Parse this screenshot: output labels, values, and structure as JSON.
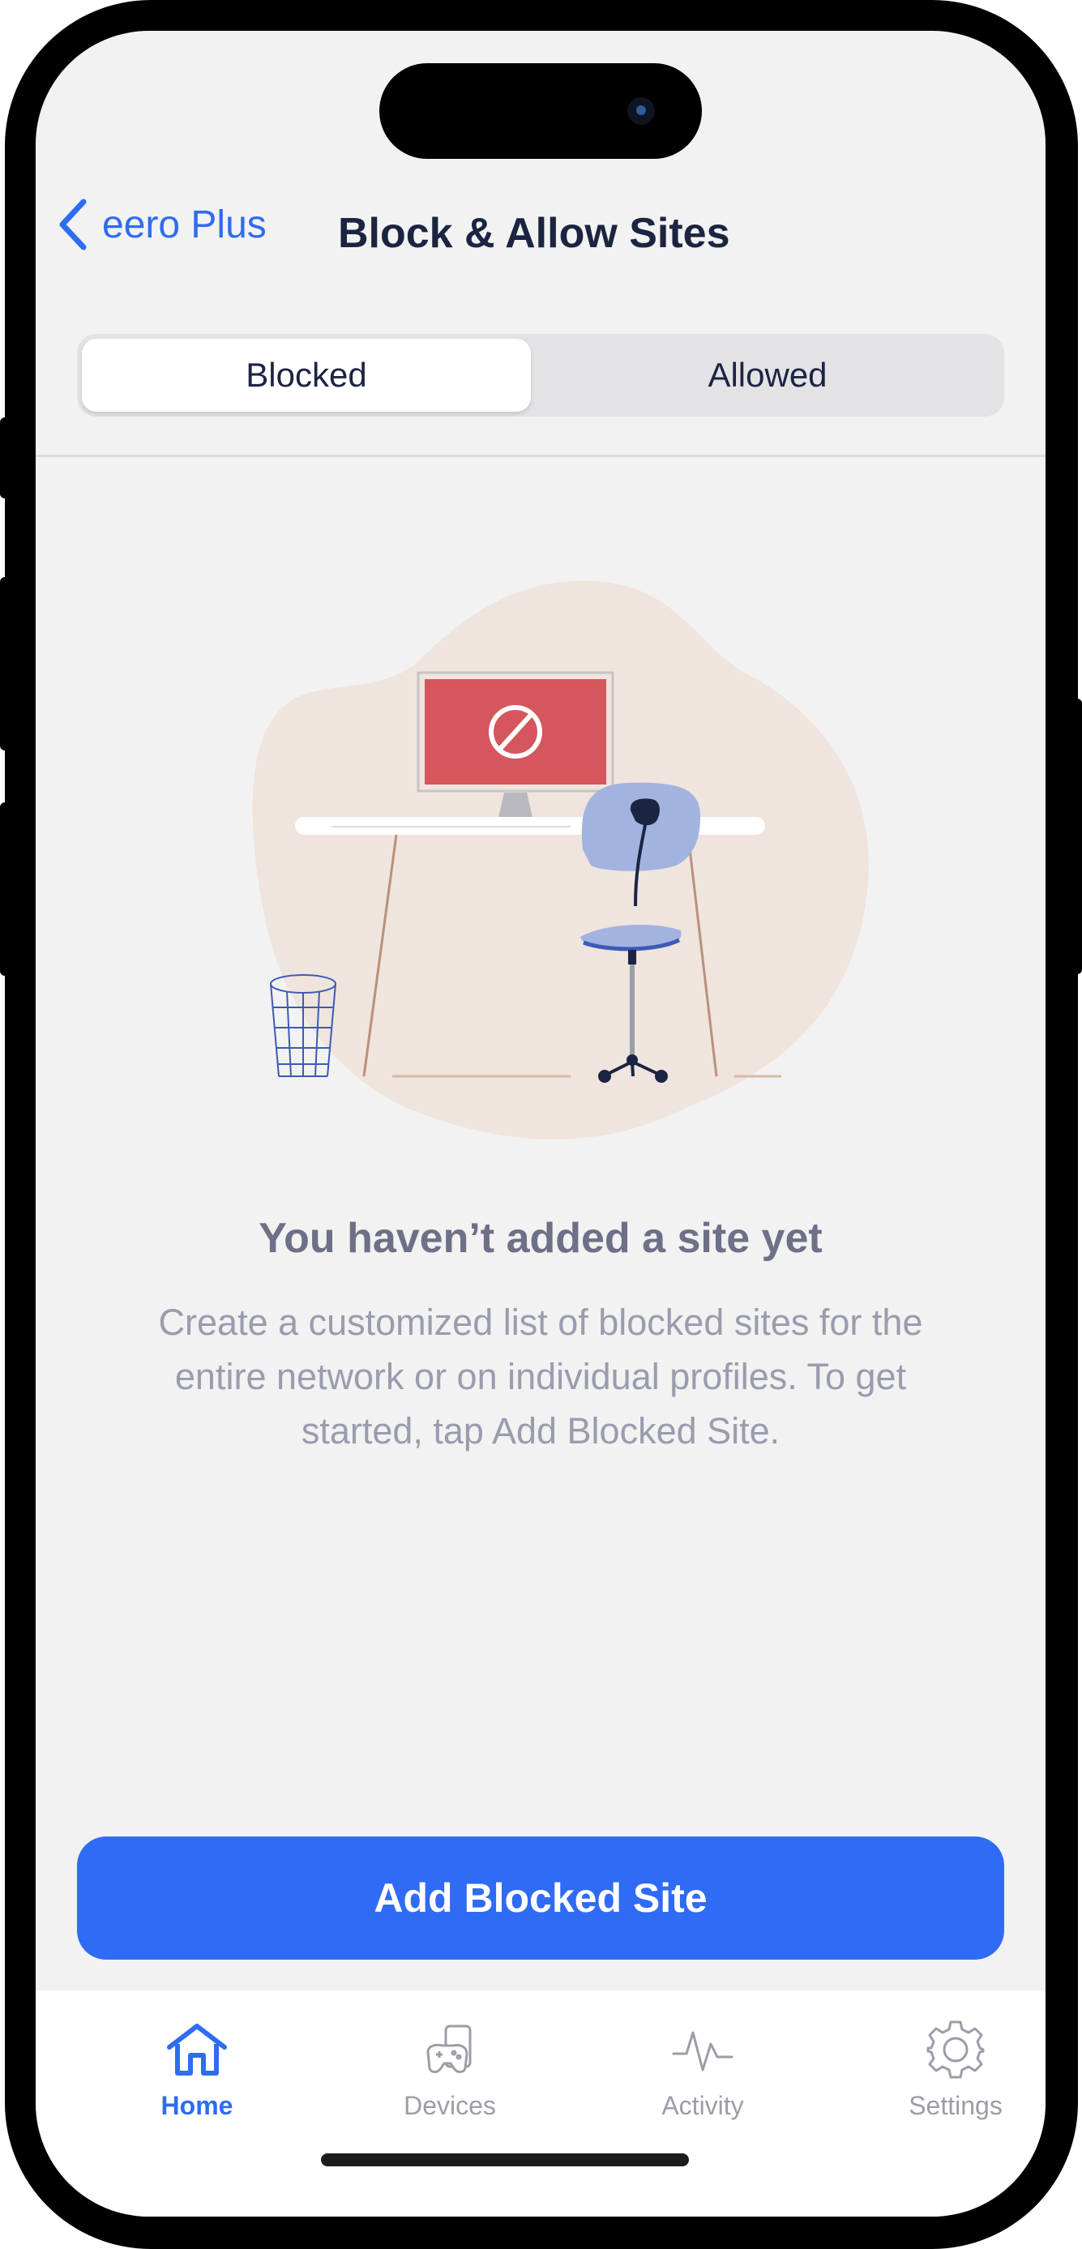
{
  "header": {
    "back_label": "eero Plus",
    "title": "Block & Allow Sites"
  },
  "segments": [
    {
      "label": "Blocked",
      "selected": true
    },
    {
      "label": "Allowed",
      "selected": false
    }
  ],
  "empty_state": {
    "title": "You haven’t added a site yet",
    "description": "Create a customized list of blocked sites for the entire network or on individual profiles. To get started, tap Add Blocked Site."
  },
  "primary_action": {
    "label": "Add Blocked Site"
  },
  "tabbar": {
    "items": [
      {
        "label": "Home",
        "icon": "home-icon",
        "active": true
      },
      {
        "label": "Devices",
        "icon": "devices-icon",
        "active": false
      },
      {
        "label": "Activity",
        "icon": "activity-icon",
        "active": false
      },
      {
        "label": "Settings",
        "icon": "settings-icon",
        "active": false
      }
    ]
  },
  "colors": {
    "accent": "#2e6cf0",
    "primary_button": "#2f6bf5",
    "title_text": "#1b2441",
    "muted_text": "#9a9cae",
    "monitor_red": "#d5565c",
    "chair_blue": "#a2b3e0",
    "blob": "#efe4de"
  }
}
